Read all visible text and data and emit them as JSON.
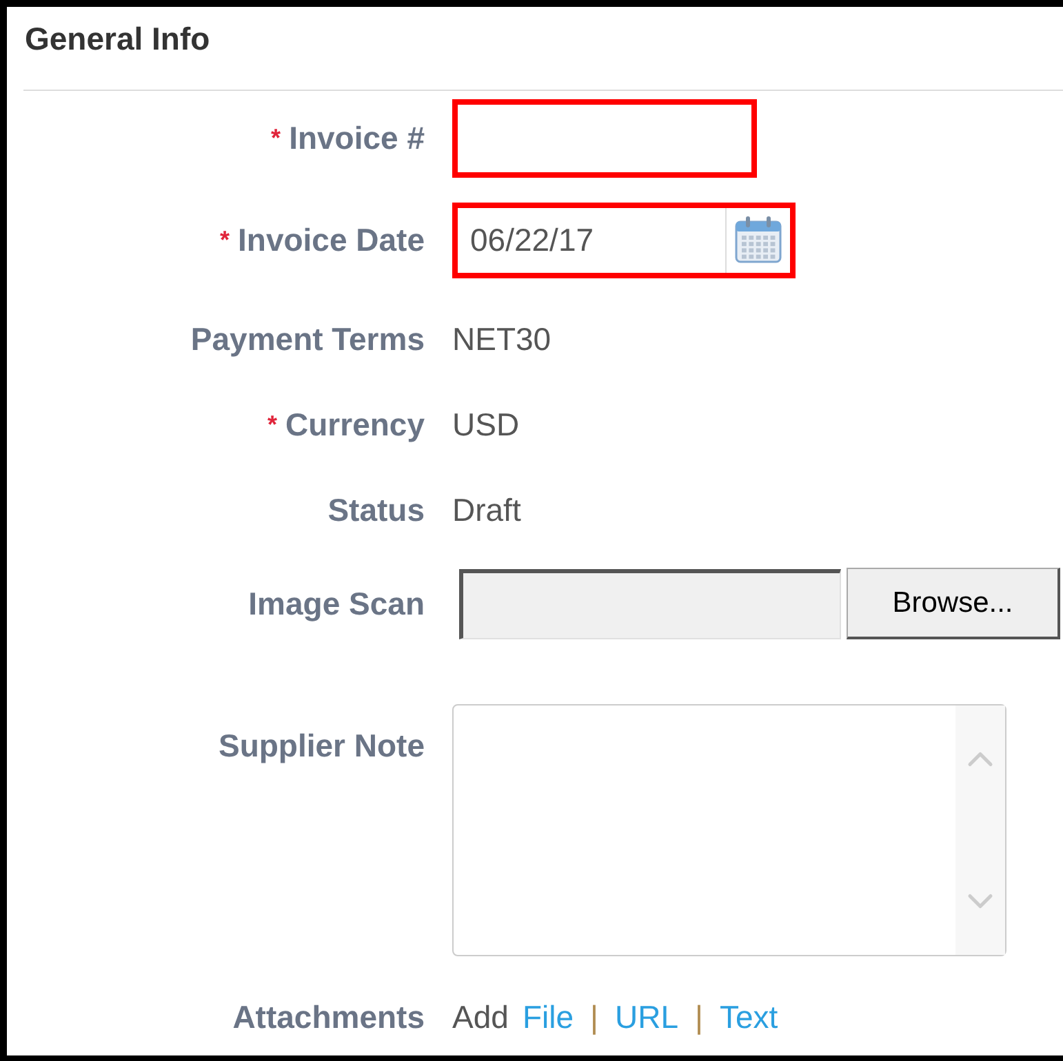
{
  "section": {
    "title": "General Info"
  },
  "required_mark": "*",
  "fields": [
    {
      "kind": "text-input",
      "label": "Invoice #",
      "required": true,
      "highlighted": true
    },
    {
      "kind": "date-input",
      "label": "Invoice Date",
      "required": true,
      "highlighted": true,
      "value": "06/22/17"
    },
    {
      "kind": "text",
      "label": "Payment Terms",
      "required": false,
      "value": "NET30"
    },
    {
      "kind": "text",
      "label": "Currency",
      "required": true,
      "value": "USD"
    },
    {
      "kind": "text",
      "label": "Status",
      "required": false,
      "value": "Draft"
    },
    {
      "kind": "file",
      "label": "Image Scan",
      "required": false,
      "button": "Browse..."
    },
    {
      "kind": "textarea",
      "label": "Supplier Note",
      "required": false
    },
    {
      "kind": "attachments",
      "label": "Attachments",
      "required": false,
      "items": [
        {
          "kind": "plain",
          "text": "Add"
        },
        {
          "kind": "link",
          "text": "File"
        },
        {
          "kind": "separator",
          "text": "|"
        },
        {
          "kind": "link",
          "text": "URL"
        },
        {
          "kind": "separator",
          "text": "|"
        },
        {
          "kind": "link",
          "text": "Text"
        }
      ]
    }
  ]
}
